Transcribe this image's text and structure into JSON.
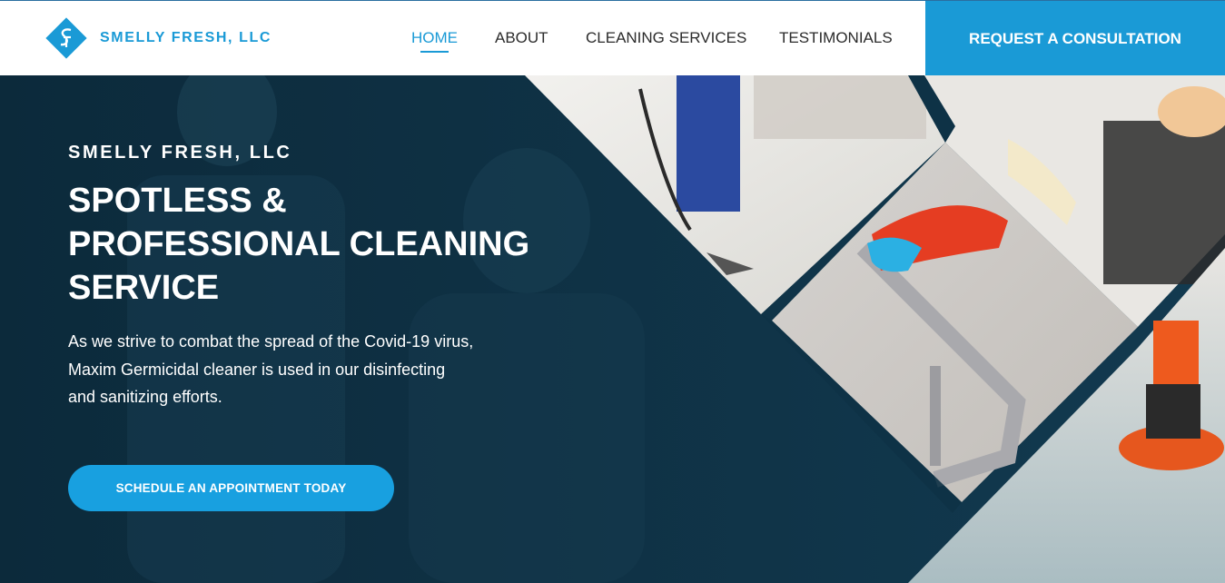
{
  "nav": {
    "logo_text": "SMELLY FRESH, LLC",
    "items": [
      {
        "label": "HOME",
        "active": true
      },
      {
        "label": "ABOUT",
        "active": false
      },
      {
        "label": "CLEANING SERVICES",
        "active": false
      },
      {
        "label": "TESTIMONIALS",
        "active": false
      }
    ],
    "cta_label": "REQUEST A CONSULTATION"
  },
  "hero": {
    "brand": "SMELLY FRESH, LLC",
    "headline": [
      "SPOTLESS &",
      "PROFESSIONAL CLEANING",
      "SERVICE"
    ],
    "description": [
      "As we strive to combat the spread of the Covid-19 virus,",
      "Maxim Germicidal cleaner is used in our disinfecting",
      "and sanitizing efforts."
    ],
    "button_label": "SCHEDULE AN APPOINTMENT TODAY"
  },
  "colors": {
    "accent": "#1a9ad6",
    "hero_overlay": "#0e3246",
    "nav_background": "#ffffff"
  },
  "icons": {
    "logo": "diamond-sf-monogram-icon"
  }
}
